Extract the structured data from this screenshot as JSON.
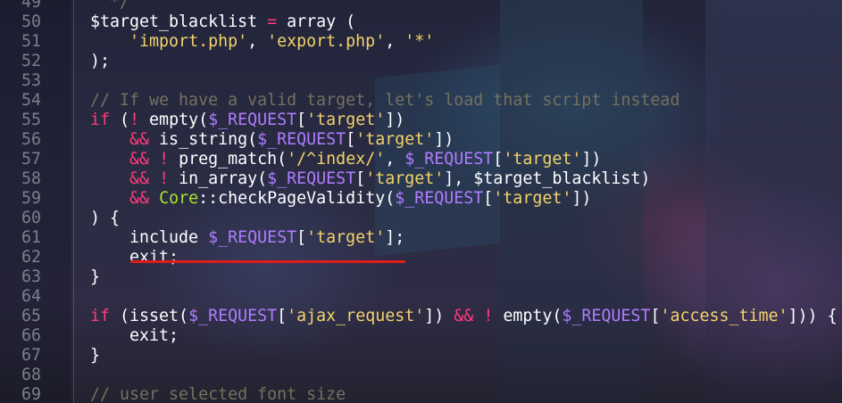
{
  "colors": {
    "keyword": "#ff3b7a",
    "string": "#f4d36a",
    "superglobal": "#b07cff",
    "class": "#a6e22e",
    "comment": "#75715e",
    "line_number": "#7c7e8c",
    "underline": "#e01b1b"
  },
  "lines": [
    {
      "num": "49",
      "tokens": [
        {
          "t": "cmt",
          "v": "  */"
        }
      ]
    },
    {
      "num": "50",
      "tokens": [
        {
          "t": "plain",
          "v": "$target_blacklist "
        },
        {
          "t": "op",
          "v": "="
        },
        {
          "t": "plain",
          "v": " array ("
        }
      ]
    },
    {
      "num": "51",
      "tokens": [
        {
          "t": "plain",
          "v": "    "
        },
        {
          "t": "str",
          "v": "'import.php'"
        },
        {
          "t": "plain",
          "v": ", "
        },
        {
          "t": "str",
          "v": "'export.php'"
        },
        {
          "t": "plain",
          "v": ", "
        },
        {
          "t": "str",
          "v": "'*'"
        }
      ]
    },
    {
      "num": "52",
      "tokens": [
        {
          "t": "plain",
          "v": ");"
        }
      ]
    },
    {
      "num": "53",
      "tokens": []
    },
    {
      "num": "54",
      "tokens": [
        {
          "t": "cmt",
          "v": "// If we have a valid target, let's load that script instead"
        }
      ]
    },
    {
      "num": "55",
      "tokens": [
        {
          "t": "kw",
          "v": "if"
        },
        {
          "t": "plain",
          "v": " ("
        },
        {
          "t": "op",
          "v": "!"
        },
        {
          "t": "plain",
          "v": " empty("
        },
        {
          "t": "var",
          "v": "$_REQUEST"
        },
        {
          "t": "plain",
          "v": "["
        },
        {
          "t": "str",
          "v": "'target'"
        },
        {
          "t": "plain",
          "v": "])"
        }
      ]
    },
    {
      "num": "56",
      "tokens": [
        {
          "t": "plain",
          "v": "    "
        },
        {
          "t": "op",
          "v": "&&"
        },
        {
          "t": "plain",
          "v": " is_string("
        },
        {
          "t": "var",
          "v": "$_REQUEST"
        },
        {
          "t": "plain",
          "v": "["
        },
        {
          "t": "str",
          "v": "'target'"
        },
        {
          "t": "plain",
          "v": "])"
        }
      ]
    },
    {
      "num": "57",
      "tokens": [
        {
          "t": "plain",
          "v": "    "
        },
        {
          "t": "op",
          "v": "&&"
        },
        {
          "t": "plain",
          "v": " "
        },
        {
          "t": "op",
          "v": "!"
        },
        {
          "t": "plain",
          "v": " preg_match("
        },
        {
          "t": "str",
          "v": "'/^index/'"
        },
        {
          "t": "plain",
          "v": ", "
        },
        {
          "t": "var",
          "v": "$_REQUEST"
        },
        {
          "t": "plain",
          "v": "["
        },
        {
          "t": "str",
          "v": "'target'"
        },
        {
          "t": "plain",
          "v": "])"
        }
      ]
    },
    {
      "num": "58",
      "tokens": [
        {
          "t": "plain",
          "v": "    "
        },
        {
          "t": "op",
          "v": "&&"
        },
        {
          "t": "plain",
          "v": " "
        },
        {
          "t": "op",
          "v": "!"
        },
        {
          "t": "plain",
          "v": " in_array("
        },
        {
          "t": "var",
          "v": "$_REQUEST"
        },
        {
          "t": "plain",
          "v": "["
        },
        {
          "t": "str",
          "v": "'target'"
        },
        {
          "t": "plain",
          "v": "], $target_blacklist)"
        }
      ]
    },
    {
      "num": "59",
      "tokens": [
        {
          "t": "plain",
          "v": "    "
        },
        {
          "t": "op",
          "v": "&&"
        },
        {
          "t": "plain",
          "v": " "
        },
        {
          "t": "cls",
          "v": "Core"
        },
        {
          "t": "plain",
          "v": "::checkPageValidity("
        },
        {
          "t": "var",
          "v": "$_REQUEST"
        },
        {
          "t": "plain",
          "v": "["
        },
        {
          "t": "str",
          "v": "'target'"
        },
        {
          "t": "plain",
          "v": "])"
        }
      ]
    },
    {
      "num": "60",
      "tokens": [
        {
          "t": "plain",
          "v": ") {"
        }
      ]
    },
    {
      "num": "61",
      "tokens": [
        {
          "t": "plain",
          "v": "    include "
        },
        {
          "t": "var",
          "v": "$_REQUEST"
        },
        {
          "t": "plain",
          "v": "["
        },
        {
          "t": "str",
          "v": "'target'"
        },
        {
          "t": "plain",
          "v": "];"
        }
      ]
    },
    {
      "num": "62",
      "tokens": [
        {
          "t": "plain",
          "v": "    exit;"
        }
      ]
    },
    {
      "num": "63",
      "tokens": [
        {
          "t": "plain",
          "v": "}"
        }
      ]
    },
    {
      "num": "64",
      "tokens": []
    },
    {
      "num": "65",
      "tokens": [
        {
          "t": "kw",
          "v": "if"
        },
        {
          "t": "plain",
          "v": " (isset("
        },
        {
          "t": "var",
          "v": "$_REQUEST"
        },
        {
          "t": "plain",
          "v": "["
        },
        {
          "t": "str",
          "v": "'ajax_request'"
        },
        {
          "t": "plain",
          "v": "]) "
        },
        {
          "t": "op",
          "v": "&&"
        },
        {
          "t": "plain",
          "v": " "
        },
        {
          "t": "op",
          "v": "!"
        },
        {
          "t": "plain",
          "v": " empty("
        },
        {
          "t": "var",
          "v": "$_REQUEST"
        },
        {
          "t": "plain",
          "v": "["
        },
        {
          "t": "str",
          "v": "'access_time'"
        },
        {
          "t": "plain",
          "v": "])) {"
        }
      ]
    },
    {
      "num": "66",
      "tokens": [
        {
          "t": "plain",
          "v": "    exit;"
        }
      ]
    },
    {
      "num": "67",
      "tokens": [
        {
          "t": "plain",
          "v": "}"
        }
      ]
    },
    {
      "num": "68",
      "tokens": []
    },
    {
      "num": "69",
      "tokens": [
        {
          "t": "cmt",
          "v": "// user selected font size"
        }
      ]
    }
  ]
}
